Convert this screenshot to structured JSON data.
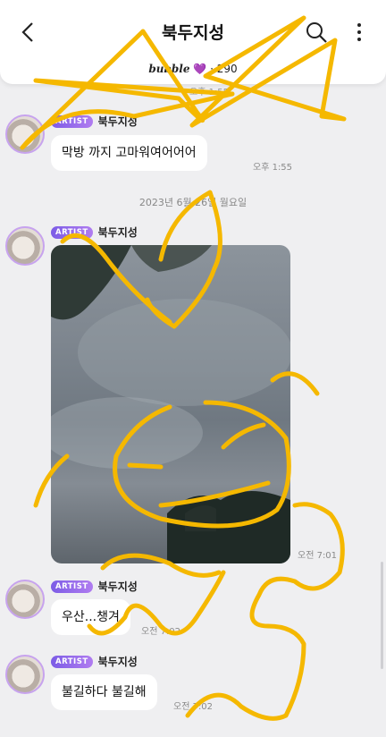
{
  "header": {
    "title": "북두지성",
    "brand": "bubble",
    "heart": "💜",
    "count_sep": "·",
    "count": "290"
  },
  "partial_time": "오후 1:55",
  "date_separator": "2023년 6월 26일 월요일",
  "messages": [
    {
      "badge": "ARTIST",
      "sender": "북두지성",
      "text": "막방 까지 고마워여어어어",
      "time": "오후 1:55"
    },
    {
      "badge": "ARTIST",
      "sender": "북두지성",
      "text": "",
      "time": "오전 7:01"
    },
    {
      "badge": "ARTIST",
      "sender": "북두지성",
      "text": "우산...챙겨",
      "time": "오전 7:02"
    },
    {
      "badge": "ARTIST",
      "sender": "북두지성",
      "text": "불길하다 불길해",
      "time": "오전 7:02"
    }
  ],
  "colors": {
    "scribble": "#f5b800",
    "badge": "#8b63e8"
  }
}
